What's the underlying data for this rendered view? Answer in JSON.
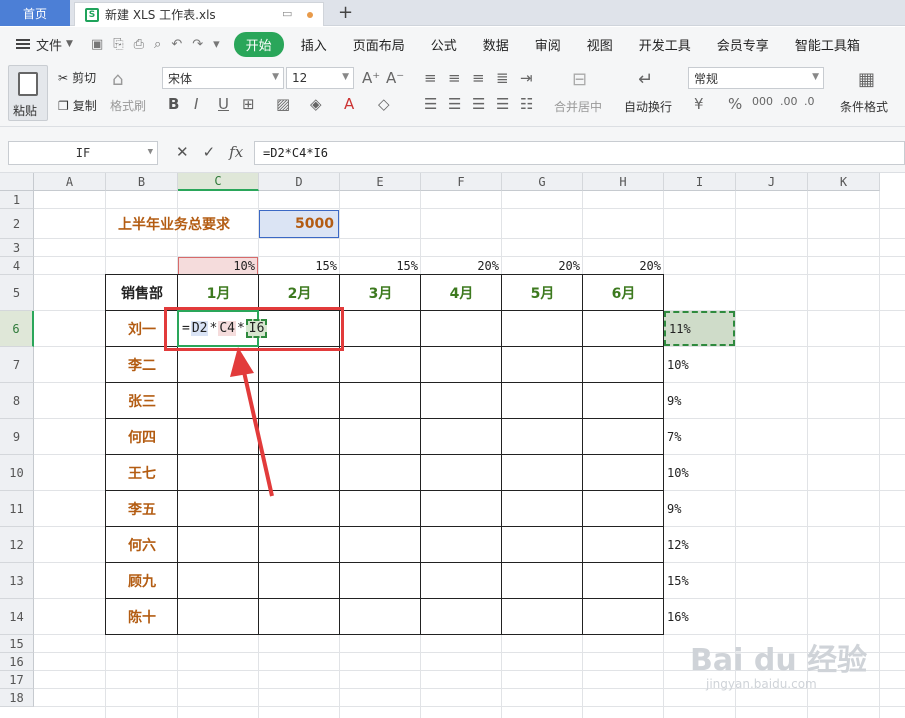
{
  "tabs": {
    "home": "首页",
    "file": "新建 XLS 工作表.xls",
    "add": "+"
  },
  "menu": {
    "file": "文件",
    "items": [
      "开始",
      "插入",
      "页面布局",
      "公式",
      "数据",
      "审阅",
      "视图",
      "开发工具",
      "会员专享",
      "智能工具箱"
    ]
  },
  "ribbon": {
    "paste": "粘贴",
    "cut": "剪切",
    "copy": "复制",
    "format_painter": "格式刷",
    "font_name": "宋体",
    "font_size": "12",
    "merge_center": "合并居中",
    "wrap_text": "自动换行",
    "number_format": "常规",
    "conditional_format": "条件格式"
  },
  "formula_bar": {
    "name_box": "IF",
    "formula": "=D2*C4*I6"
  },
  "columns": [
    "A",
    "B",
    "C",
    "D",
    "E",
    "F",
    "G",
    "H",
    "I",
    "J",
    "K"
  ],
  "rows": [
    "1",
    "2",
    "3",
    "4",
    "5",
    "6",
    "7",
    "8",
    "9",
    "10",
    "11",
    "12",
    "13",
    "14",
    "15",
    "16",
    "17",
    "18"
  ],
  "sheet": {
    "title": "上半年业务总要求",
    "target": "5000",
    "percents": [
      "10%",
      "15%",
      "15%",
      "20%",
      "20%",
      "20%"
    ],
    "dept_header": "销售部",
    "months": [
      "1月",
      "2月",
      "3月",
      "4月",
      "5月",
      "6月"
    ],
    "names": [
      "刘一",
      "李二",
      "张三",
      "何四",
      "王七",
      "李五",
      "何六",
      "顾九",
      "陈十"
    ],
    "i_values": [
      "11%",
      "10%",
      "9%",
      "7%",
      "10%",
      "9%",
      "12%",
      "15%",
      "16%"
    ],
    "edit_tokens": [
      "=",
      "D2",
      "*",
      "C4",
      "*",
      "I6"
    ]
  },
  "watermark": {
    "brand": "Bai du 经验",
    "url": "jingyan.baidu.com"
  }
}
